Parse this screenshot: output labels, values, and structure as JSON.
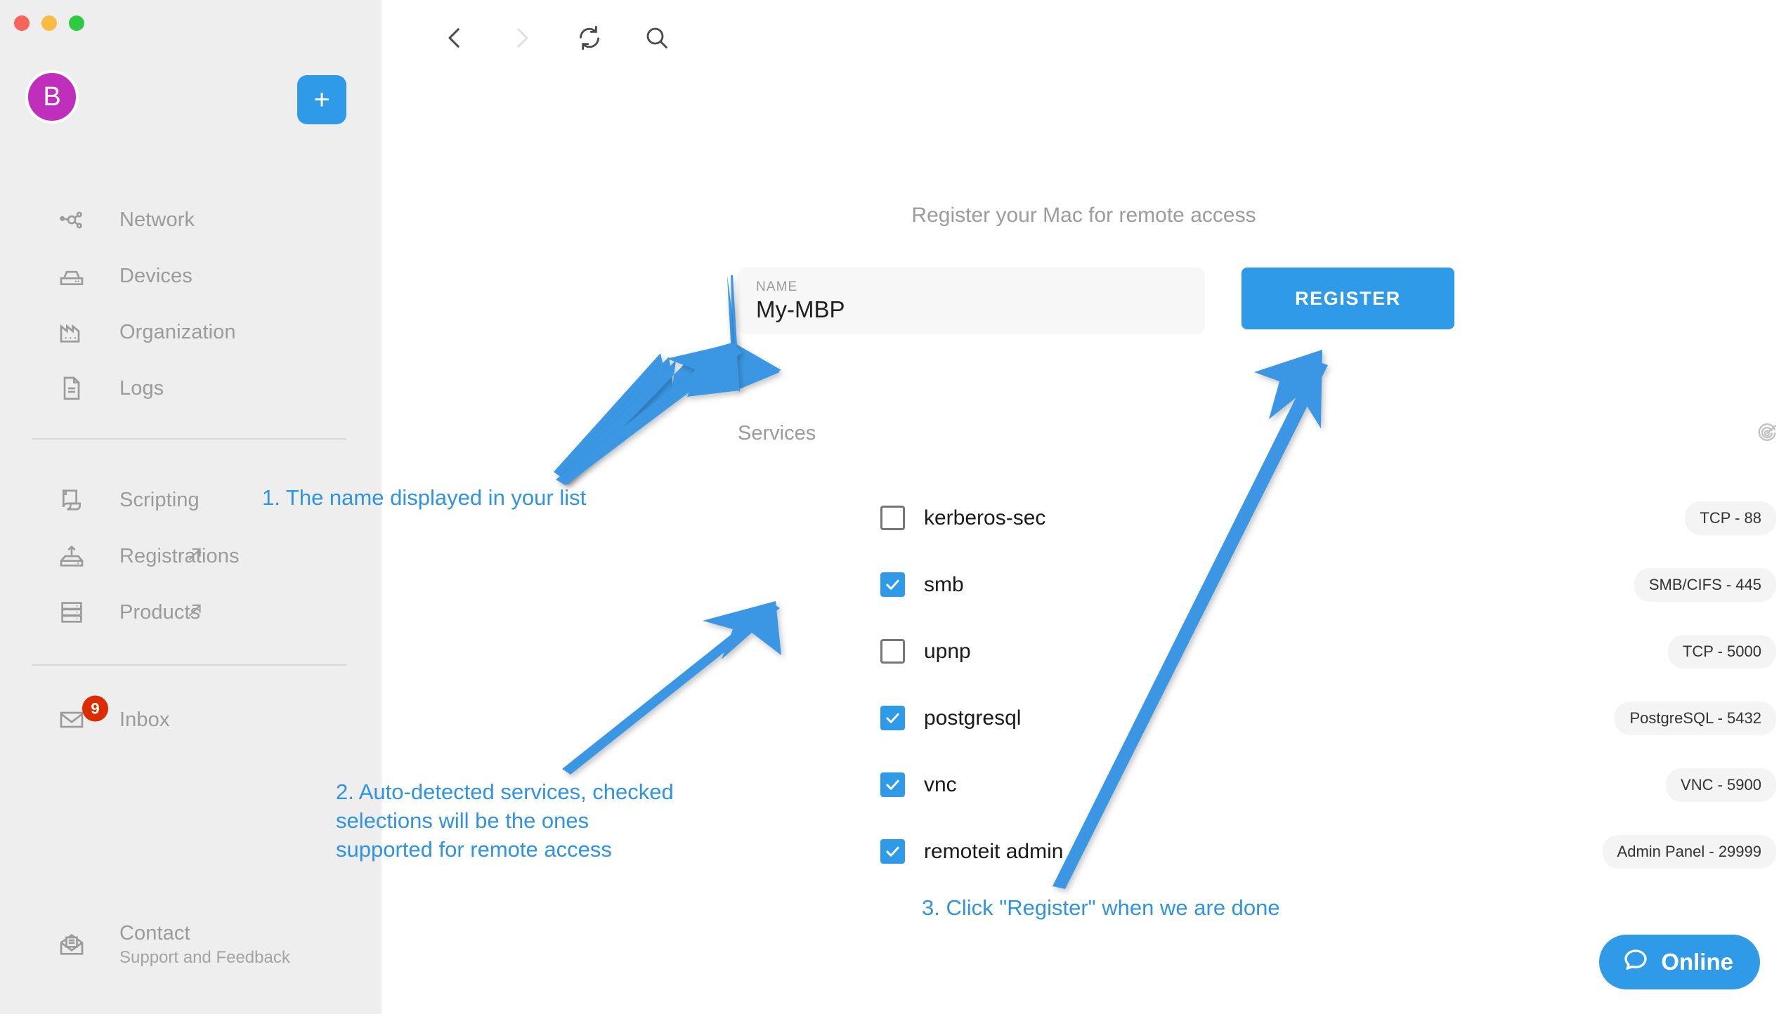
{
  "window": {
    "traffic_lights": [
      "close",
      "minimize",
      "maximize"
    ],
    "colors": {
      "close": "#f6655b",
      "minimize": "#f9bc40",
      "maximize": "#2dcb42"
    }
  },
  "sidebar": {
    "avatar_initial": "B",
    "avatar_color": "#bf2fbb",
    "add_button_label": "+",
    "add_button_color": "#2f9ae8",
    "groups": [
      {
        "items": [
          {
            "label": "Network",
            "icon": "network-icon",
            "external": false
          },
          {
            "label": "Devices",
            "icon": "devices-icon",
            "external": false
          },
          {
            "label": "Organization",
            "icon": "organization-icon",
            "external": false
          },
          {
            "label": "Logs",
            "icon": "logs-icon",
            "external": false
          }
        ]
      },
      {
        "items": [
          {
            "label": "Scripting",
            "icon": "scripting-icon",
            "external": false
          },
          {
            "label": "Registrations",
            "icon": "registrations-icon",
            "external": true
          },
          {
            "label": "Products",
            "icon": "products-icon",
            "external": true
          }
        ]
      },
      {
        "items": [
          {
            "label": "Inbox",
            "icon": "inbox-icon",
            "external": false,
            "badge": "9",
            "badge_color": "#dd2c00"
          }
        ]
      },
      {
        "items": [
          {
            "label": "Contact",
            "sublabel": "Support and Feedback",
            "icon": "contact-icon",
            "external": false
          }
        ]
      }
    ]
  },
  "toolbar": {
    "back": "back-icon",
    "forward": "forward-icon",
    "refresh": "refresh-icon",
    "search": "search-icon"
  },
  "main": {
    "page_title": "Register your Mac for remote access",
    "name_field": {
      "label": "NAME",
      "value": "My-MBP",
      "placeholder": "Name"
    },
    "register_button": {
      "label": "REGISTER",
      "color": "#2f9ae8"
    },
    "services_title": "Services",
    "scan_icon": "radar-scan-icon",
    "services": [
      {
        "name": "kerberos-sec",
        "checked": false,
        "port": "TCP - 88"
      },
      {
        "name": "smb",
        "checked": true,
        "port": "SMB/CIFS - 445"
      },
      {
        "name": "upnp",
        "checked": false,
        "port": "TCP - 5000"
      },
      {
        "name": "postgresql",
        "checked": true,
        "port": "PostgreSQL - 5432"
      },
      {
        "name": "vnc",
        "checked": true,
        "port": "VNC - 5900"
      },
      {
        "name": "remoteit admin",
        "checked": true,
        "port": "Admin Panel - 29999"
      }
    ]
  },
  "annotations": {
    "color": "#2f93e4",
    "step1": "1. The name displayed in your list",
    "step2": "2. Auto-detected services, checked\nselections will be the ones\nsupported for remote access",
    "step3": "3. Click \"Register\" when we are done"
  },
  "chat_widget": {
    "label": "Online",
    "icon": "chat-bubble-icon",
    "color": "#2f9ae8"
  }
}
